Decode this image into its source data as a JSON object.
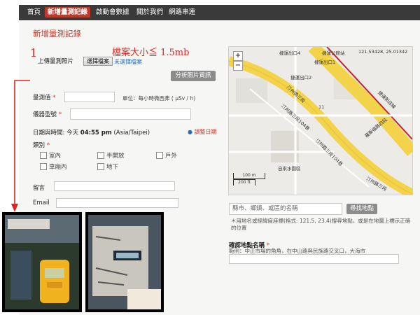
{
  "nav": [
    {
      "label": "首頁",
      "active": false
    },
    {
      "label": "新增量測記錄",
      "active": true
    },
    {
      "label": "啟動會數據",
      "active": false
    },
    {
      "label": "關於我們",
      "active": false
    },
    {
      "label": "網路串連",
      "active": false
    }
  ],
  "page_title": "新增量測記錄",
  "annotation": {
    "step_number": "1",
    "file_size_note": "檔案大小≦ 1.5mb"
  },
  "upload": {
    "label": "上傳量測照片",
    "choose_button": "選擇檔案",
    "no_file": "未選擇檔案",
    "analyze_button": "分析照片資訊"
  },
  "form": {
    "measure_label": "量測值",
    "unit_label": "單位：每小時微西弗 ( μSv / h)",
    "device_label": "儀器型號",
    "datetime_label": "日期與時間: 今天",
    "datetime_value": "04:55 pm",
    "timezone": "(Asia/Taipei)",
    "change_date": "調整日期",
    "category_label": "類別",
    "categories": [
      "室內",
      "半開放",
      "戶外",
      "車廂內",
      "地下"
    ],
    "comment_label": "留言",
    "email_label": "Email"
  },
  "map": {
    "labels": [
      "捷運出口4",
      "捷運公館站",
      "121.53428, 25.01342",
      "捷運出口1",
      "捷運出口2",
      "汀州路三段",
      "捷運新店線",
      "羅斯福路四段",
      "汀州路三段104巷",
      "自來水園區",
      "汀州路三段104巷",
      "汀州路三段",
      "11"
    ],
    "scale_m": "100 m",
    "scale_ft": "200 ft"
  },
  "address": {
    "placeholder": "縣市、鄉鎮、或區的名稱",
    "search_button": "尋找地點",
    "note": "＊用地名或經緯度座標(格式: 121.5, 23.4)搜尋地點，或是在地圖上標示正確的位置",
    "confirm_label": "確認地點名稱",
    "confirm_hint": "範例：中正市場的角角，在中山路與民族路交叉口，大海市"
  },
  "colors": {
    "accent": "#c0392b",
    "annotation": "#e0251f",
    "road_major": "#f3d34a",
    "metro_line": "#c8202e"
  }
}
